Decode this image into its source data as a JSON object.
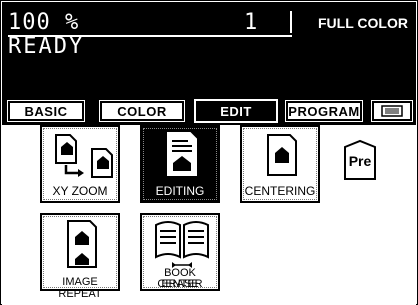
{
  "status": {
    "copies": "100  %",
    "count": "1",
    "color_mode": "FULL COLOR",
    "message": "READY"
  },
  "tabs": [
    {
      "label": "BASIC",
      "active": false
    },
    {
      "label": "COLOR",
      "active": false
    },
    {
      "label": "EDIT",
      "active": true
    },
    {
      "label": "PROGRAM",
      "active": false
    }
  ],
  "tab_list_icon": "list-icon",
  "functions": [
    {
      "label": "XY ZOOM",
      "icon": "xy-zoom-icon",
      "active": false
    },
    {
      "label": "EDITING",
      "icon": "editing-icon",
      "active": true
    },
    {
      "label": "CENTERING",
      "icon": "centering-icon",
      "active": false
    },
    {
      "label": "IMAGE REPEAT",
      "icon": "image-repeat-icon",
      "active": false
    },
    {
      "label_line1": "BOOK CENTER",
      "label_line2": "ERASE",
      "icon": "book-center-erase-icon",
      "active": false
    }
  ],
  "preset": {
    "label": "Pre",
    "icon": "preset-icon"
  }
}
